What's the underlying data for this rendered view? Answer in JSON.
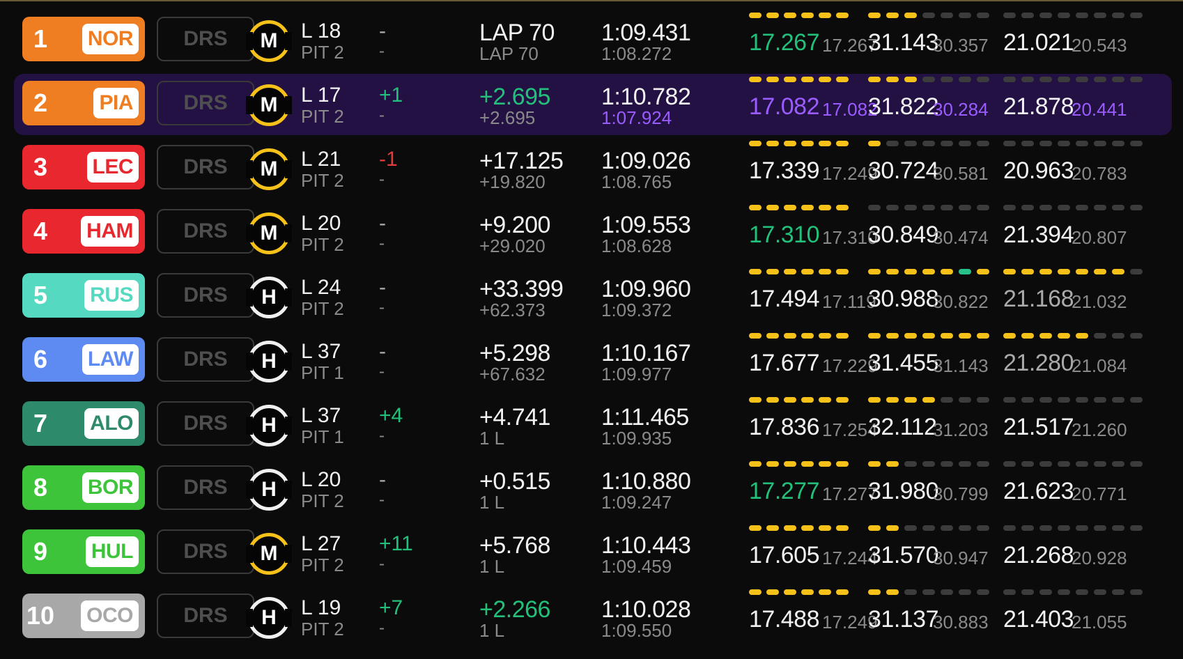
{
  "colors": {
    "green": "#22c07a",
    "purple": "#9a5cff",
    "yellow": "#f6c21a",
    "red": "#e23b3b",
    "drs_inactive": "#4f4f4f",
    "highlight_row": "#241144"
  },
  "drs_label": "DRS",
  "drivers": [
    {
      "pos": "1",
      "code": "NOR",
      "team_color": "#ef7d22",
      "tyre": "M",
      "tyre_type": "medium",
      "lap": "L 18",
      "pit": "PIT 2",
      "delta": "-",
      "delta_state": "none",
      "delta_sub": "-",
      "gap": "LAP 70",
      "gap_sub": "LAP 70",
      "gap_color": "white",
      "last": "1:09.431",
      "best": "1:08.272",
      "best_color": "muted",
      "highlight": false,
      "sectors": [
        {
          "value": "17.267",
          "value_color": "green",
          "best": "17.267",
          "best_color": "muted",
          "minis": [
            "y",
            "y",
            "y",
            "y",
            "y",
            "y"
          ]
        },
        {
          "value": "31.143",
          "value_color": "white",
          "best": "30.357",
          "best_color": "muted",
          "minis": [
            "y",
            "y",
            "y",
            "n",
            "n",
            "n",
            "n"
          ]
        },
        {
          "value": "21.021",
          "value_color": "white",
          "best": "20.543",
          "best_color": "muted",
          "minis": [
            "n",
            "n",
            "n",
            "n",
            "n",
            "n",
            "n",
            "n"
          ]
        }
      ]
    },
    {
      "pos": "2",
      "code": "PIA",
      "team_color": "#ef7d22",
      "tyre": "M",
      "tyre_type": "medium",
      "lap": "L 17",
      "pit": "PIT 2",
      "delta": "+1",
      "delta_state": "up",
      "delta_sub": "-",
      "gap": "+2.695",
      "gap_sub": "+2.695",
      "gap_color": "green",
      "last": "1:10.782",
      "best": "1:07.924",
      "best_color": "purple",
      "highlight": true,
      "sectors": [
        {
          "value": "17.082",
          "value_color": "purple",
          "best": "17.082",
          "best_color": "purple",
          "minis": [
            "y",
            "y",
            "y",
            "y",
            "y",
            "y"
          ]
        },
        {
          "value": "31.822",
          "value_color": "white",
          "best": "30.284",
          "best_color": "purple",
          "minis": [
            "y",
            "y",
            "y",
            "n",
            "n",
            "n",
            "n"
          ]
        },
        {
          "value": "21.878",
          "value_color": "white",
          "best": "20.441",
          "best_color": "purple",
          "minis": [
            "n",
            "n",
            "n",
            "n",
            "n",
            "n",
            "n",
            "n"
          ]
        }
      ]
    },
    {
      "pos": "3",
      "code": "LEC",
      "team_color": "#e8272f",
      "tyre": "M",
      "tyre_type": "medium",
      "lap": "L 21",
      "pit": "PIT 2",
      "delta": "-1",
      "delta_state": "down",
      "delta_sub": "-",
      "gap": "+17.125",
      "gap_sub": "+19.820",
      "gap_color": "white",
      "last": "1:09.026",
      "best": "1:08.765",
      "best_color": "muted",
      "highlight": false,
      "sectors": [
        {
          "value": "17.339",
          "value_color": "white",
          "best": "17.249",
          "best_color": "muted",
          "minis": [
            "y",
            "y",
            "y",
            "y",
            "y",
            "y"
          ]
        },
        {
          "value": "30.724",
          "value_color": "white",
          "best": "30.581",
          "best_color": "muted",
          "minis": [
            "y",
            "n",
            "n",
            "n",
            "n",
            "n",
            "n"
          ]
        },
        {
          "value": "20.963",
          "value_color": "white",
          "best": "20.783",
          "best_color": "muted",
          "minis": [
            "n",
            "n",
            "n",
            "n",
            "n",
            "n",
            "n",
            "n"
          ]
        }
      ]
    },
    {
      "pos": "4",
      "code": "HAM",
      "team_color": "#e8272f",
      "tyre": "M",
      "tyre_type": "medium",
      "lap": "L 20",
      "pit": "PIT 2",
      "delta": "-",
      "delta_state": "none",
      "delta_sub": "-",
      "gap": "+9.200",
      "gap_sub": "+29.020",
      "gap_color": "white",
      "last": "1:09.553",
      "best": "1:08.628",
      "best_color": "muted",
      "highlight": false,
      "sectors": [
        {
          "value": "17.310",
          "value_color": "green",
          "best": "17.310",
          "best_color": "muted",
          "minis": [
            "y",
            "y",
            "y",
            "y",
            "y",
            "y"
          ]
        },
        {
          "value": "30.849",
          "value_color": "white",
          "best": "30.474",
          "best_color": "muted",
          "minis": [
            "n",
            "n",
            "n",
            "n",
            "n",
            "n",
            "n"
          ]
        },
        {
          "value": "21.394",
          "value_color": "white",
          "best": "20.807",
          "best_color": "muted",
          "minis": [
            "n",
            "n",
            "n",
            "n",
            "n",
            "n",
            "n",
            "n"
          ]
        }
      ]
    },
    {
      "pos": "5",
      "code": "RUS",
      "team_color": "#55d9c0",
      "tyre": "H",
      "tyre_type": "hard",
      "lap": "L 24",
      "pit": "PIT 2",
      "delta": "-",
      "delta_state": "none",
      "delta_sub": "-",
      "gap": "+33.399",
      "gap_sub": "+62.373",
      "gap_color": "white",
      "last": "1:09.960",
      "best": "1:09.372",
      "best_color": "muted",
      "highlight": false,
      "sectors": [
        {
          "value": "17.494",
          "value_color": "white",
          "best": "17.119",
          "best_color": "muted",
          "minis": [
            "y",
            "y",
            "y",
            "y",
            "y",
            "y"
          ]
        },
        {
          "value": "30.988",
          "value_color": "white",
          "best": "30.822",
          "best_color": "muted",
          "minis": [
            "y",
            "y",
            "y",
            "y",
            "y",
            "g",
            "y"
          ]
        },
        {
          "value": "21.168",
          "value_color": "dim",
          "best": "21.032",
          "best_color": "muted",
          "minis": [
            "y",
            "y",
            "y",
            "y",
            "y",
            "y",
            "y",
            "n"
          ]
        }
      ]
    },
    {
      "pos": "6",
      "code": "LAW",
      "team_color": "#5d8bf2",
      "tyre": "H",
      "tyre_type": "hard",
      "lap": "L 37",
      "pit": "PIT 1",
      "delta": "-",
      "delta_state": "none",
      "delta_sub": "-",
      "gap": "+5.298",
      "gap_sub": "+67.632",
      "gap_color": "white",
      "last": "1:10.167",
      "best": "1:09.977",
      "best_color": "muted",
      "highlight": false,
      "sectors": [
        {
          "value": "17.677",
          "value_color": "white",
          "best": "17.229",
          "best_color": "muted",
          "minis": [
            "y",
            "y",
            "y",
            "y",
            "y",
            "y"
          ]
        },
        {
          "value": "31.455",
          "value_color": "white",
          "best": "31.143",
          "best_color": "muted",
          "minis": [
            "y",
            "y",
            "y",
            "y",
            "y",
            "y",
            "y"
          ]
        },
        {
          "value": "21.280",
          "value_color": "dim",
          "best": "21.084",
          "best_color": "muted",
          "minis": [
            "y",
            "y",
            "y",
            "y",
            "y",
            "n",
            "n",
            "n"
          ]
        }
      ]
    },
    {
      "pos": "7",
      "code": "ALO",
      "team_color": "#2d8a6a",
      "tyre": "H",
      "tyre_type": "hard",
      "lap": "L 37",
      "pit": "PIT 1",
      "delta": "+4",
      "delta_state": "up",
      "delta_sub": "-",
      "gap": "+4.741",
      "gap_sub": "1 L",
      "gap_color": "white",
      "last": "1:11.465",
      "best": "1:09.935",
      "best_color": "muted",
      "highlight": false,
      "sectors": [
        {
          "value": "17.836",
          "value_color": "white",
          "best": "17.254",
          "best_color": "muted",
          "minis": [
            "y",
            "y",
            "y",
            "y",
            "y",
            "y"
          ]
        },
        {
          "value": "32.112",
          "value_color": "white",
          "best": "31.203",
          "best_color": "muted",
          "minis": [
            "y",
            "y",
            "y",
            "y",
            "n",
            "n",
            "n"
          ]
        },
        {
          "value": "21.517",
          "value_color": "white",
          "best": "21.260",
          "best_color": "muted",
          "minis": [
            "n",
            "n",
            "n",
            "n",
            "n",
            "n",
            "n",
            "n"
          ]
        }
      ]
    },
    {
      "pos": "8",
      "code": "BOR",
      "team_color": "#3dc43a",
      "tyre": "H",
      "tyre_type": "hard",
      "lap": "L 20",
      "pit": "PIT 2",
      "delta": "-",
      "delta_state": "none",
      "delta_sub": "-",
      "gap": "+0.515",
      "gap_sub": "1 L",
      "gap_color": "white",
      "last": "1:10.880",
      "best": "1:09.247",
      "best_color": "muted",
      "highlight": false,
      "sectors": [
        {
          "value": "17.277",
          "value_color": "green",
          "best": "17.277",
          "best_color": "muted",
          "minis": [
            "y",
            "y",
            "y",
            "y",
            "y",
            "y"
          ]
        },
        {
          "value": "31.980",
          "value_color": "white",
          "best": "30.799",
          "best_color": "muted",
          "minis": [
            "y",
            "y",
            "n",
            "n",
            "n",
            "n",
            "n"
          ]
        },
        {
          "value": "21.623",
          "value_color": "white",
          "best": "20.771",
          "best_color": "muted",
          "minis": [
            "n",
            "n",
            "n",
            "n",
            "n",
            "n",
            "n",
            "n"
          ]
        }
      ]
    },
    {
      "pos": "9",
      "code": "HUL",
      "team_color": "#3dc43a",
      "tyre": "M",
      "tyre_type": "medium",
      "lap": "L 27",
      "pit": "PIT 2",
      "delta": "+11",
      "delta_state": "up",
      "delta_sub": "-",
      "gap": "+5.768",
      "gap_sub": "1 L",
      "gap_color": "white",
      "last": "1:10.443",
      "best": "1:09.459",
      "best_color": "muted",
      "highlight": false,
      "sectors": [
        {
          "value": "17.605",
          "value_color": "white",
          "best": "17.244",
          "best_color": "muted",
          "minis": [
            "y",
            "y",
            "y",
            "y",
            "y",
            "y"
          ]
        },
        {
          "value": "31.570",
          "value_color": "white",
          "best": "30.947",
          "best_color": "muted",
          "minis": [
            "y",
            "y",
            "n",
            "n",
            "n",
            "n",
            "n"
          ]
        },
        {
          "value": "21.268",
          "value_color": "white",
          "best": "20.928",
          "best_color": "muted",
          "minis": [
            "n",
            "n",
            "n",
            "n",
            "n",
            "n",
            "n",
            "n"
          ]
        }
      ]
    },
    {
      "pos": "10",
      "code": "OCO",
      "team_color": "#a8a8a8",
      "tyre": "H",
      "tyre_type": "hard",
      "lap": "L 19",
      "pit": "PIT 2",
      "delta": "+7",
      "delta_state": "up",
      "delta_sub": "-",
      "gap": "+2.266",
      "gap_sub": "1 L",
      "gap_color": "green",
      "last": "1:10.028",
      "best": "1:09.550",
      "best_color": "muted",
      "highlight": false,
      "sectors": [
        {
          "value": "17.488",
          "value_color": "white",
          "best": "17.249",
          "best_color": "muted",
          "minis": [
            "y",
            "y",
            "y",
            "y",
            "y",
            "y"
          ]
        },
        {
          "value": "31.137",
          "value_color": "white",
          "best": "30.883",
          "best_color": "muted",
          "minis": [
            "y",
            "y",
            "n",
            "n",
            "n",
            "n",
            "n"
          ]
        },
        {
          "value": "21.403",
          "value_color": "white",
          "best": "21.055",
          "best_color": "muted",
          "minis": [
            "n",
            "n",
            "n",
            "n",
            "n",
            "n",
            "n",
            "n"
          ]
        }
      ]
    }
  ]
}
